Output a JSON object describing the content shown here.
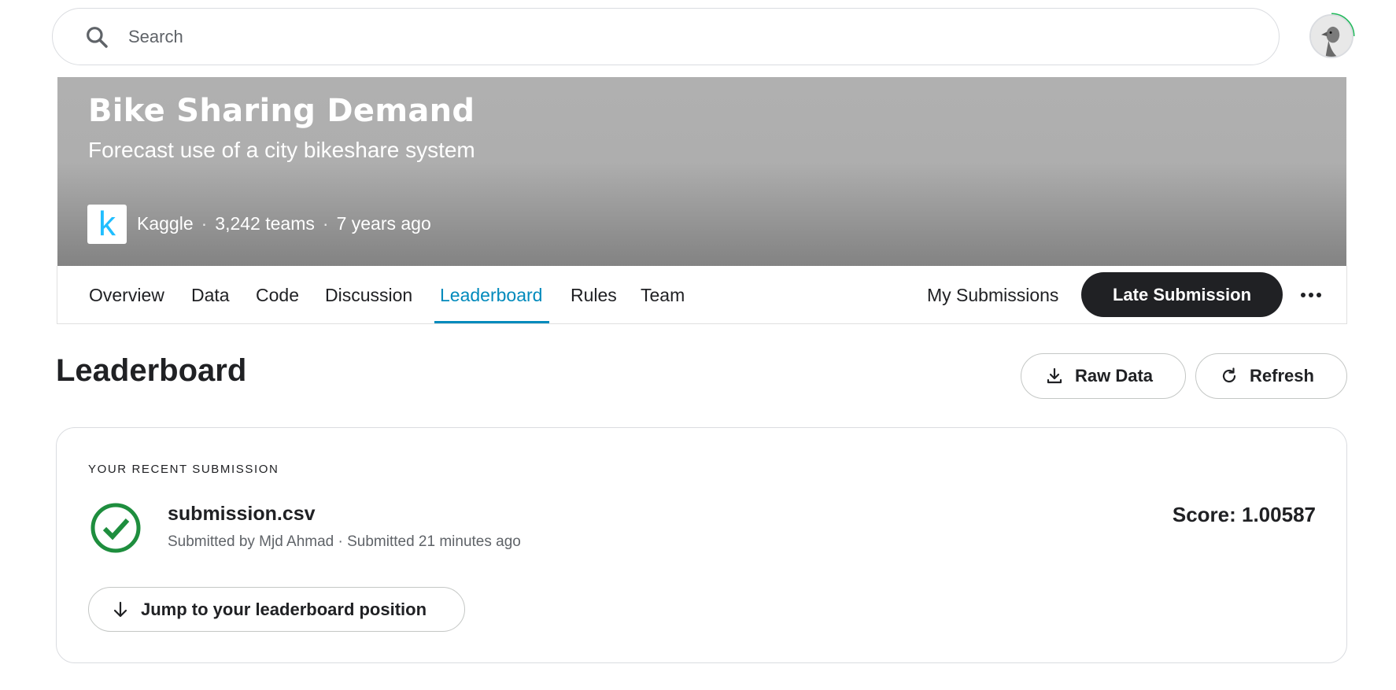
{
  "search": {
    "placeholder": "Search"
  },
  "competition": {
    "title": "Bike Sharing Demand",
    "subtitle": "Forecast use of a city bikeshare system",
    "host_logo_letter": "k",
    "host": "Kaggle",
    "separator": "·",
    "teams": "3,242 teams",
    "age": "7 years ago"
  },
  "tabs": [
    {
      "label": "Overview",
      "active": false
    },
    {
      "label": "Data",
      "active": false
    },
    {
      "label": "Code",
      "active": false
    },
    {
      "label": "Discussion",
      "active": false
    },
    {
      "label": "Leaderboard",
      "active": true
    },
    {
      "label": "Rules",
      "active": false
    },
    {
      "label": "Team",
      "active": false
    }
  ],
  "actions": {
    "my_submissions": "My Submissions",
    "late_submission": "Late Submission"
  },
  "leaderboard": {
    "title": "Leaderboard",
    "raw_data": "Raw Data",
    "refresh": "Refresh"
  },
  "recent_submission": {
    "label": "YOUR RECENT SUBMISSION",
    "file_name": "submission.csv",
    "meta": "Submitted by Mjd Ahmad · Submitted 21 minutes ago",
    "score": "Score: 1.00587",
    "jump_label": "Jump to your leaderboard position"
  },
  "colors": {
    "accent": "#008abc",
    "success": "#1e8e3e",
    "primary_button": "#202124",
    "kaggle_blue": "#20beff"
  }
}
